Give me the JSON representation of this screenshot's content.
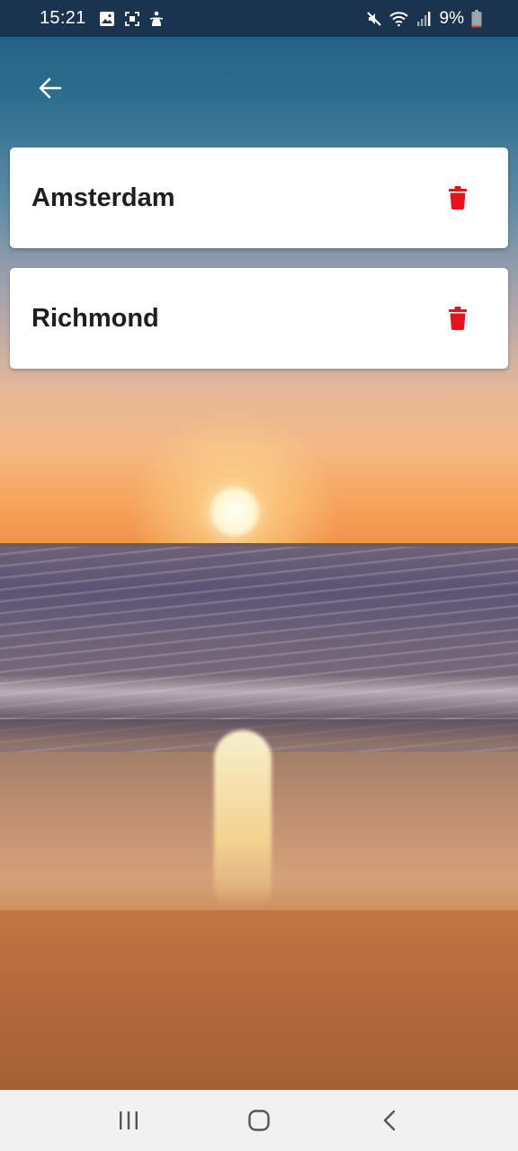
{
  "status_bar": {
    "time": "15:21",
    "battery_percent": "9%",
    "left_icons": [
      "image-icon",
      "screenshot-icon",
      "accessibility-icon"
    ],
    "right_icons": [
      "mute-icon",
      "wifi-icon",
      "signal-icon",
      "battery-icon"
    ],
    "battery_level_fraction": 0.09,
    "battery_color": "#e53935"
  },
  "header": {
    "back_icon": "arrow-left-icon"
  },
  "cities": [
    {
      "name": "Amsterdam",
      "action_icon": "trash-icon"
    },
    {
      "name": "Richmond",
      "action_icon": "trash-icon"
    }
  ],
  "nav_bar": {
    "buttons": [
      "recent-apps-icon",
      "home-icon",
      "back-icon"
    ]
  },
  "colors": {
    "status_bar_bg": "#1a3450",
    "card_bg": "#ffffff",
    "delete_icon": "#e8101a",
    "city_text": "#1e1e1e",
    "nav_bar_bg": "#f1f1f1"
  }
}
